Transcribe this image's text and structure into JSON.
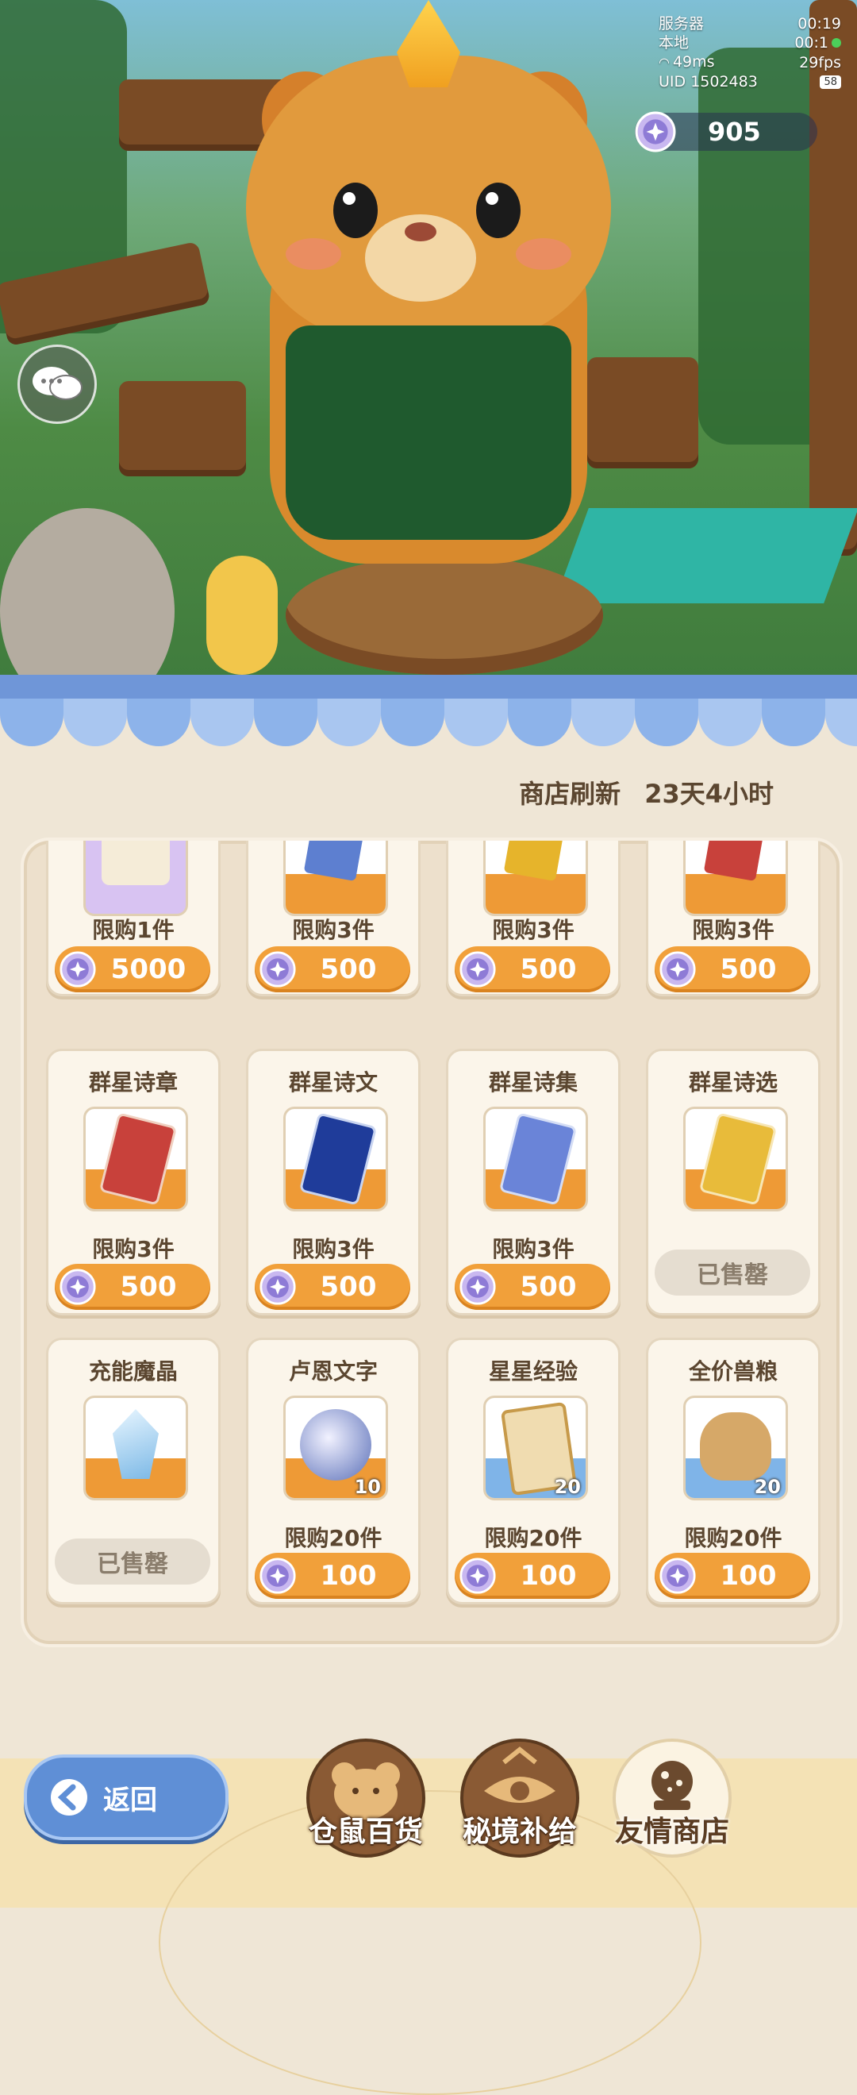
{
  "hud": {
    "server_label": "服务器",
    "server_time": "00:19",
    "local_label": "本地",
    "local_time": "00:1",
    "ping": "49ms",
    "fps": "29fps",
    "uid_label": "UID",
    "uid": "1502483",
    "badge": "58"
  },
  "currency": {
    "amount": "905",
    "icon": "star-coin-icon"
  },
  "shop": {
    "refresh_label": "商店刷新",
    "refresh_time": "23天4小时"
  },
  "items": [
    {
      "name": "",
      "limit": "限购1件",
      "price": "5000",
      "thumb": "scroll"
    },
    {
      "name": "",
      "limit": "限购3件",
      "price": "500",
      "thumb": "card-blue"
    },
    {
      "name": "",
      "limit": "限购3件",
      "price": "500",
      "thumb": "card-gold"
    },
    {
      "name": "",
      "limit": "限购3件",
      "price": "500",
      "thumb": "card-red"
    },
    {
      "name": "群星诗章",
      "limit": "限购3件",
      "price": "500",
      "thumb": "card-red"
    },
    {
      "name": "群星诗文",
      "limit": "限购3件",
      "price": "500",
      "thumb": "card-navy"
    },
    {
      "name": "群星诗集",
      "limit": "限购3件",
      "price": "500",
      "thumb": "card-periwinkle"
    },
    {
      "name": "群星诗选",
      "limit": "",
      "price": "",
      "soldout": "已售罄",
      "thumb": "card-yellow"
    },
    {
      "name": "充能魔晶",
      "limit": "",
      "price": "",
      "soldout": "已售罄",
      "thumb": "crystal"
    },
    {
      "name": "卢恩文字",
      "limit": "限购20件",
      "price": "100",
      "qty": "10",
      "thumb": "rune-orb"
    },
    {
      "name": "星星经验",
      "limit": "限购20件",
      "price": "100",
      "qty": "20",
      "thumb": "star-card"
    },
    {
      "name": "全价兽粮",
      "limit": "限购20件",
      "price": "100",
      "qty": "20",
      "thumb": "food-bag"
    }
  ],
  "nav": {
    "back_label": "返回",
    "tabs": [
      {
        "label": "仓鼠百货",
        "icon": "hamster-face-icon"
      },
      {
        "label": "秘境补给",
        "icon": "eye-emblem-icon"
      },
      {
        "label": "友情商店",
        "icon": "crystal-ball-icon"
      }
    ]
  },
  "colors": {
    "price_orange": "#f1a03a",
    "back_blue": "#5f8fd6",
    "panel_bg": "#ede0cc"
  }
}
